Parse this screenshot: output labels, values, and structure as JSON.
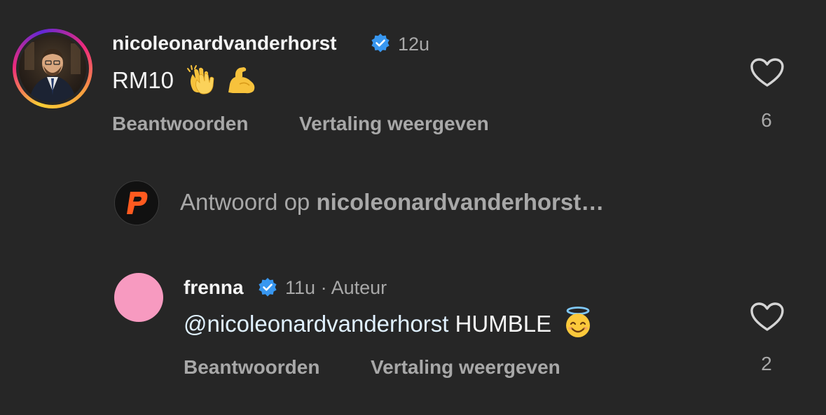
{
  "comment1": {
    "username": "nicoleonardvanderhorst",
    "time": "12u",
    "text": "RM10",
    "emojis": [
      "clapping-hands",
      "flexed-biceps"
    ],
    "reply_label": "Beantwoorden",
    "translate_label": "Vertaling weergeven",
    "likes": "6"
  },
  "reply_input": {
    "prefix": "Antwoord op",
    "target": "nicoleonardvanderhorst…"
  },
  "comment2": {
    "username": "frenna",
    "time": "11u",
    "separator": "·",
    "author_tag": "Auteur",
    "mention": "@nicoleonardvanderhorst",
    "text": "HUMBLE",
    "emojis": [
      "smiling-face-with-halo"
    ],
    "reply_label": "Beantwoorden",
    "translate_label": "Vertaling weergeven",
    "likes": "2"
  },
  "colors": {
    "background": "#262626",
    "text": "#f5f5f5",
    "muted": "#a8a8a8",
    "verified": "#3897f0",
    "brand_orange": "#ff5a1f",
    "avatar_pink": "#f79ac0"
  }
}
